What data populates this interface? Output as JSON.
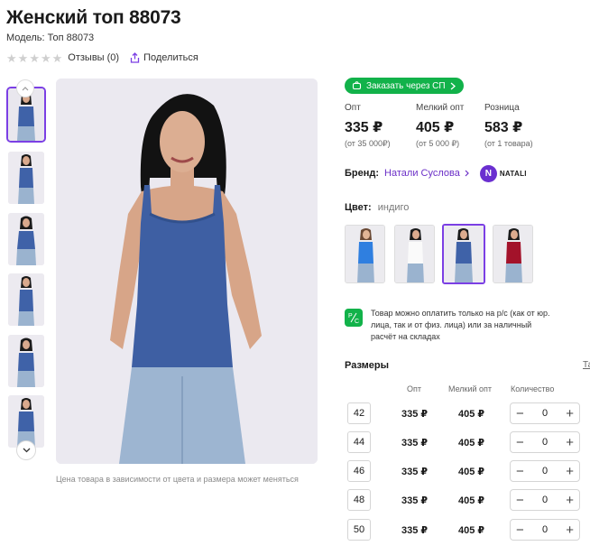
{
  "product": {
    "title": "Женский топ 88073",
    "model": "Модель: Топ 88073",
    "reviews_label": "Отзывы (0)",
    "rating": 0,
    "share_label": "Поделиться"
  },
  "gallery": {
    "photo_note": "Цена товара в зависимости от цвета и размера может меняться"
  },
  "order_sp_label": "Заказать через СП",
  "prices": [
    {
      "label": "Опт",
      "value": "335 ₽",
      "sub": "(от 35 000₽)"
    },
    {
      "label": "Мелкий опт",
      "value": "405 ₽",
      "sub": "(от 5 000 ₽)"
    },
    {
      "label": "Розница",
      "value": "583 ₽",
      "sub": "(от 1 товара)"
    }
  ],
  "brand": {
    "label": "Бренд:",
    "name": "Натали Суслова",
    "logo_letter": "N",
    "logo_text": "NATALI"
  },
  "color": {
    "label": "Цвет:",
    "value": "индиго"
  },
  "payment_note": "Товар можно оплатить только на р/с (как от юр. лица, так и от физ. лица) или за наличный расчёт на складах",
  "sizes": {
    "title": "Размеры",
    "table_link": "Та",
    "headers": {
      "opt": "Опт",
      "small_opt": "Мелкий опт",
      "qty": "Количество"
    },
    "rows": [
      {
        "size": "42",
        "opt": "335 ₽",
        "small_opt": "405 ₽",
        "qty": "0"
      },
      {
        "size": "44",
        "opt": "335 ₽",
        "small_opt": "405 ₽",
        "qty": "0"
      },
      {
        "size": "46",
        "opt": "335 ₽",
        "small_opt": "405 ₽",
        "qty": "0"
      },
      {
        "size": "48",
        "opt": "335 ₽",
        "small_opt": "405 ₽",
        "qty": "0"
      },
      {
        "size": "50",
        "opt": "335 ₽",
        "small_opt": "405 ₽",
        "qty": "0"
      }
    ]
  },
  "icons": {
    "star": "star-icon",
    "share": "share-icon",
    "cart": "cart-icon",
    "chevron": "chevron-right-icon",
    "payment": "payment-rs-icon"
  },
  "colors": {
    "accent": "#7b3fe4",
    "green": "#12b24a",
    "brand_link": "#6b2fc7"
  }
}
